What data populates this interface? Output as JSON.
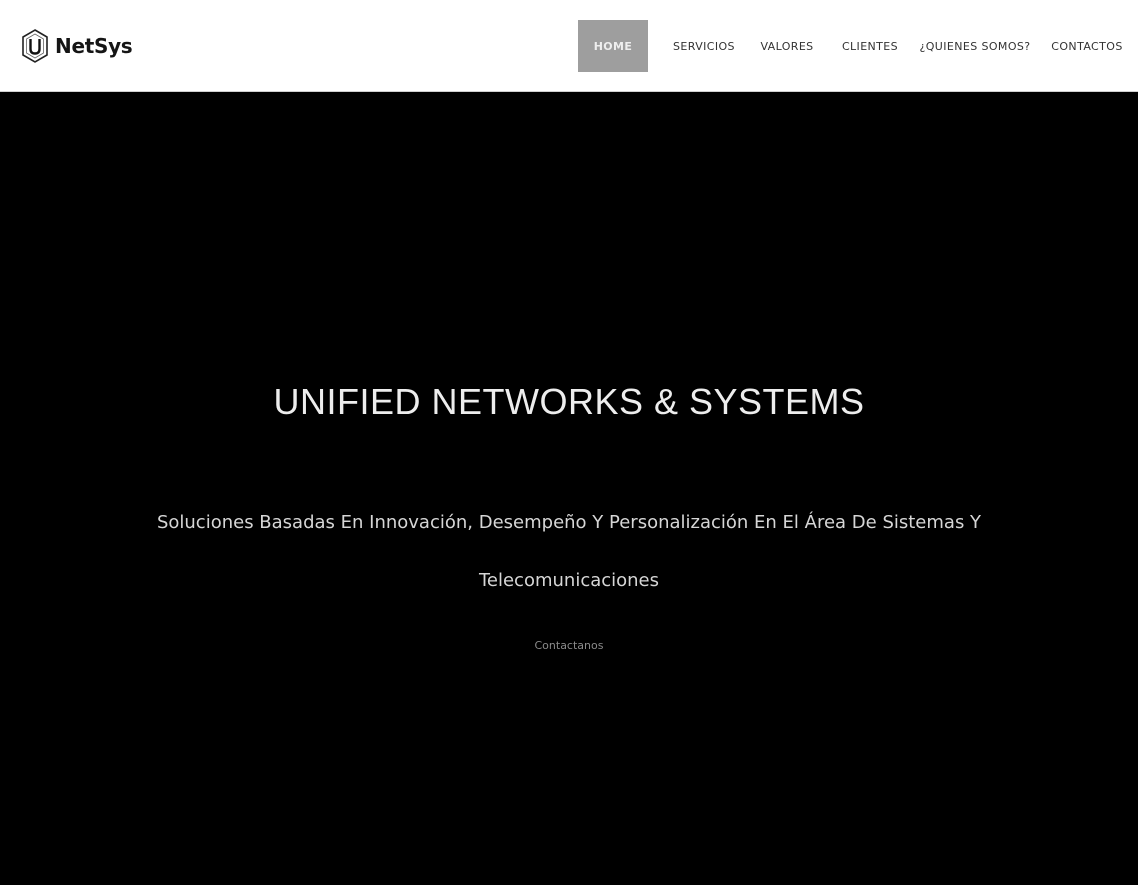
{
  "navbar": {
    "brand_name": "NetSys",
    "brand_icon": "u-hexagon-logo",
    "menu": [
      {
        "label": "HOME",
        "active": true
      },
      {
        "label": "SERVICIOS",
        "active": false
      },
      {
        "label": "VALORES",
        "active": false
      },
      {
        "label": "CLIENTES",
        "active": false
      },
      {
        "label": "¿QUIENES SOMOS?",
        "active": false
      },
      {
        "label": "CONTACTOS",
        "active": false
      }
    ]
  },
  "hero": {
    "title": "UNIFIED NETWORKS & SYSTEMS",
    "subtitle": "Soluciones Basadas En Innovación, Desempeño Y Personalización En El Área De Sistemas Y Telecomunicaciones",
    "cta_label": "Contactanos"
  },
  "colors": {
    "navbar_bg": "#ffffff",
    "hero_bg": "#000000",
    "active_menu_bg": "#9e9e9e",
    "title_text": "#ededed"
  }
}
